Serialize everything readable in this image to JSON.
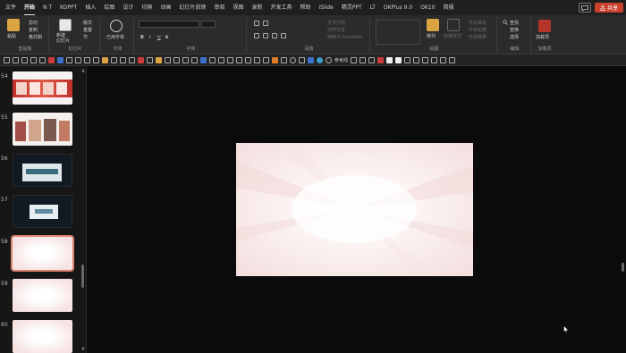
{
  "menu": {
    "items": [
      "文件",
      "开始",
      "N T",
      "KOPPT",
      "插入",
      "绘图",
      "设计",
      "切换",
      "动画",
      "幻灯片放映",
      "审阅",
      "视图",
      "录制",
      "开发工具",
      "帮助",
      "iSlide",
      "LT",
      "OKPlus 9.0",
      "OK10",
      "简报"
    ],
    "items_row": [
      "文件",
      "开始",
      "N T",
      "KOPPT",
      "插入",
      "绘图",
      "设计",
      "切换",
      "动画",
      "幻灯片放映",
      "审阅",
      "视图",
      "录制",
      "开发工具",
      "帮助",
      "iSlide",
      "精灵PPT",
      "LT",
      "OKPlus 9.0",
      "OK10",
      "简报"
    ],
    "active": "开始",
    "share_label": "共享",
    "share_color": "#c9402c"
  },
  "ribbon": {
    "clipboard": {
      "paste": "粘贴",
      "cut": "剪切",
      "copy": "复制",
      "format_painter": "格式刷",
      "label": "剪贴板"
    },
    "slides": {
      "new_slide": "新建\n幻灯片",
      "layout": "版式",
      "reset": "重置",
      "section": "节",
      "label": "幻灯片"
    },
    "font_tools": {
      "used_fonts": "已用字体",
      "label": "字体"
    },
    "font": {
      "bold": "B",
      "italic": "I",
      "underline": "U",
      "strike": "S",
      "label": "字体"
    },
    "paragraph": {
      "text_direction": "文字方向",
      "align_text": "对齐文本",
      "smartart": "转换为 SmartArt",
      "label": "段落"
    },
    "drawing": {
      "arrange": "排列",
      "quick_styles": "快速样式",
      "shape_fill": "形状填充",
      "shape_outline": "形状轮廓",
      "shape_effects": "形状效果",
      "label": "绘图"
    },
    "editing": {
      "find": "查找",
      "replace": "替换",
      "select": "选择",
      "label": "编辑"
    },
    "addins": {
      "addin": "加载项",
      "label": "加载项"
    }
  },
  "qat": {
    "reference_line": "参考线"
  },
  "slides": [
    {
      "number": "54",
      "theme": "red-collage"
    },
    {
      "number": "55",
      "theme": "photo-cards"
    },
    {
      "number": "56",
      "theme": "dark-screen"
    },
    {
      "number": "57",
      "theme": "dark-screen-small"
    },
    {
      "number": "58",
      "theme": "pink-blank",
      "selected": true
    },
    {
      "number": "59",
      "theme": "pink-blank"
    },
    {
      "number": "60",
      "theme": "pink-blank"
    }
  ],
  "colors": {
    "accent": "#c9402c",
    "selection_outline": "#d9826a",
    "slide_bg": "#fdf2f2"
  }
}
